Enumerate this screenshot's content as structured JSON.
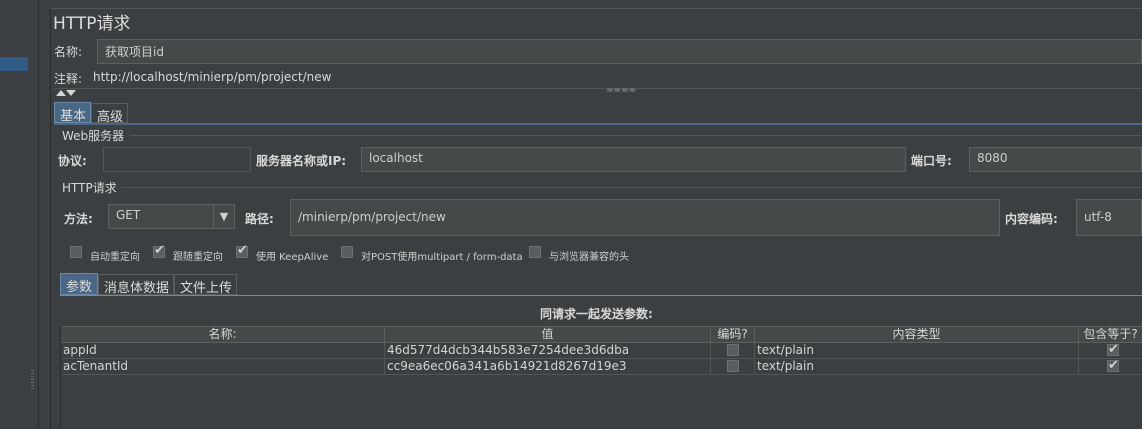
{
  "panel": {
    "title": "HTTP请求"
  },
  "name_row": {
    "label": "名称:",
    "value": "获取项目id"
  },
  "comment_row": {
    "label": "注释:",
    "value": "http://localhost/minierp/pm/project/new"
  },
  "collapse_grip": "≈≈≈≈",
  "main_tabs": [
    {
      "label": "基本",
      "active": true
    },
    {
      "label": "高级",
      "active": false
    }
  ],
  "web_server": {
    "legend": "Web服务器",
    "protocol_label": "协议:",
    "protocol_value": "",
    "server_label": "服务器名称或IP:",
    "server_value": "localhost",
    "port_label": "端口号:",
    "port_value": "8080"
  },
  "http_request": {
    "legend": "HTTP请求",
    "method_label": "方法:",
    "method_value": "GET",
    "path_label": "路径:",
    "path_value": "/minierp/pm/project/new",
    "encoding_label": "内容编码:",
    "encoding_value": "utf-8"
  },
  "options": [
    {
      "label": "自动重定向",
      "checked": false
    },
    {
      "label": "跟随重定向",
      "checked": true
    },
    {
      "label": "使用 KeepAlive",
      "checked": true
    },
    {
      "label": "对POST使用multipart / form-data",
      "checked": false
    },
    {
      "label": "与浏览器兼容的头",
      "checked": false
    }
  ],
  "param_tabs": [
    {
      "label": "参数",
      "active": true
    },
    {
      "label": "消息体数据",
      "active": false
    },
    {
      "label": "文件上传",
      "active": false
    }
  ],
  "params_title": "同请求一起发送参数:",
  "table": {
    "headers": [
      "名称:",
      "值",
      "编码?",
      "内容类型",
      "包含等于?"
    ],
    "rows": [
      {
        "name": "appId",
        "value": "46d577d4dcb344b583e7254dee3d6dba",
        "encode": false,
        "content_type": "text/plain",
        "include_equals": true
      },
      {
        "name": "acTenantId",
        "value": "cc9ea6ec06a341a6b14921d8267d19e3",
        "encode": false,
        "content_type": "text/plain",
        "include_equals": true
      }
    ]
  },
  "colors": {
    "selection": "#2f5a86",
    "tab_active": "#4a6784",
    "background": "#3c3f41"
  },
  "icons": {
    "dropdown": "chevron-down-icon",
    "check": "checkmark-icon",
    "expand": "arrow-up-icon",
    "collapse": "arrow-down-icon"
  }
}
